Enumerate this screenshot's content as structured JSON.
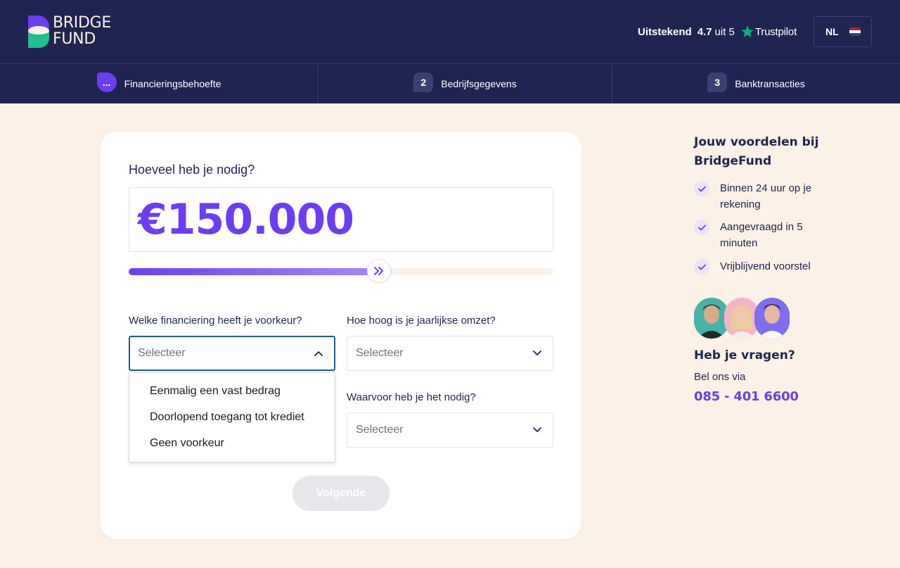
{
  "brand": {
    "line1": "BRIDGE",
    "line2": "FUND",
    "icon": "bridgefund-logo"
  },
  "rating": {
    "word": "Uitstekend",
    "score": "4.7",
    "of": "uit 5",
    "provider": "Trustpilot",
    "icon": "trustpilot-star-icon",
    "star_color": "#00b67a"
  },
  "language": {
    "code": "NL",
    "icon": "netherlands-flag-icon"
  },
  "steps": [
    {
      "badge": "...",
      "label": "Financieringsbehoefte",
      "active": true
    },
    {
      "badge": "2",
      "label": "Bedrijfsgegevens",
      "active": false
    },
    {
      "badge": "3",
      "label": "Banktransacties",
      "active": false
    }
  ],
  "form": {
    "amount_question": "Hoeveel heb je nodig?",
    "amount_value": "€150.000",
    "slider_level": 0.59,
    "financing_type": {
      "label": "Welke financiering heeft je voorkeur?",
      "value": "Selecteer",
      "open": true,
      "options": [
        "Eenmalig een vast bedrag",
        "Doorlopend toegang tot krediet",
        "Geen voorkeur"
      ]
    },
    "revenue": {
      "label": "Hoe hoog is je jaarlijkse omzet?",
      "value": "Selecteer"
    },
    "purpose": {
      "label": "Waarvoor heb je het nodig?",
      "value": "Selecteer"
    },
    "next_label": "Volgende"
  },
  "sidebar": {
    "title": "Jouw voordelen bij BridgeFund",
    "benefits": [
      "Binnen 24 uur op je rekening",
      "Aangevraagd in 5 minuten",
      "Vrijblijvend voorstel"
    ],
    "help_title": "Heb je vragen?",
    "help_sub": "Bel ons via",
    "phone": "085 - 401 6600"
  },
  "colors": {
    "navy": "#1f2550",
    "purple": "#6c3df3",
    "cream": "#fcf1e6",
    "green": "#1fbf8f"
  }
}
